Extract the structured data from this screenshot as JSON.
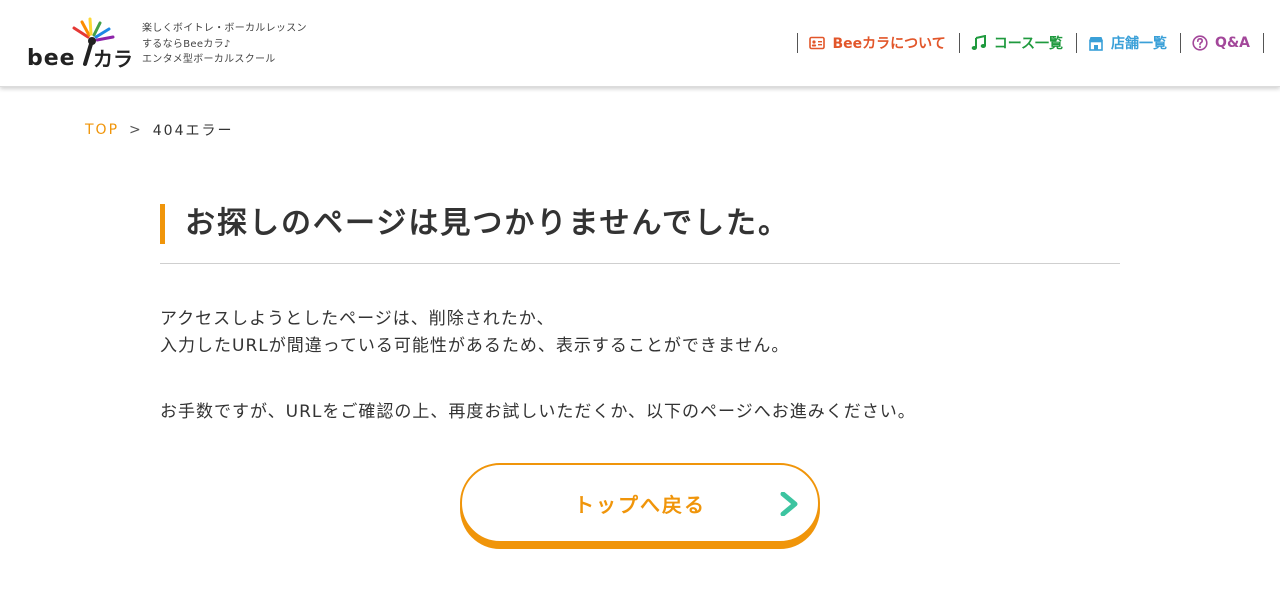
{
  "header": {
    "logo_alt": "beeカラ",
    "tagline": [
      "楽しくボイトレ・ボーカルレッスン",
      "するならBeeカラ♪",
      "エンタメ型ボーカルスクール"
    ],
    "nav": [
      {
        "label": "Beeカラについて",
        "icon": "id-card-icon",
        "color": "#e2562a"
      },
      {
        "label": "コース一覧",
        "icon": "music-note-icon",
        "color": "#1f9a3e"
      },
      {
        "label": "店舗一覧",
        "icon": "store-icon",
        "color": "#3aa0d8"
      },
      {
        "label": "Q&A",
        "icon": "question-circle-icon",
        "color": "#a3479a"
      }
    ]
  },
  "breadcrumb": {
    "top": "TOP",
    "separator": ">",
    "current": "404エラー"
  },
  "main": {
    "title": "お探しのページは見つかりませんでした。",
    "paragraph1_line1": "アクセスしようとしたページは、削除されたか、",
    "paragraph1_line2": "入力したURLが間違っている可能性があるため、表示することができません。",
    "paragraph2": "お手数ですが、URLをご確認の上、再度お試しいただくか、以下のページへお進みください。",
    "button_label": "トップへ戻る"
  },
  "colors": {
    "accent": "#f0950a",
    "about": "#e2562a",
    "course": "#1f9a3e",
    "store": "#3aa0d8",
    "qa": "#a3479a",
    "arrow": "#3cc4a0"
  }
}
